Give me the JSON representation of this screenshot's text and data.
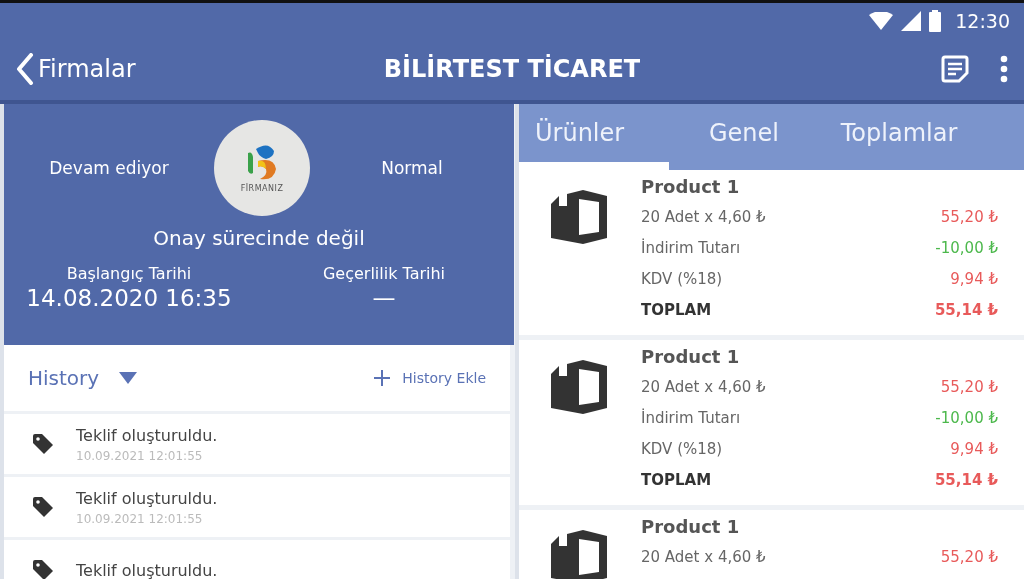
{
  "status_bar": {
    "time": "12:30"
  },
  "app_bar": {
    "back_label": "Firmalar",
    "title": "BİLİRTEST TİCARET"
  },
  "summary": {
    "status_left": "Devam ediyor",
    "logo_text": "FİRMANIZ",
    "status_right": "Normal",
    "approval": "Onay sürecinde değil",
    "start_label": "Başlangıç Tarihi",
    "start_value": "14.08.2020 16:35",
    "valid_label": "Geçerlilik Tarihi",
    "valid_value": "—"
  },
  "history": {
    "title": "History",
    "add_label": "History Ekle",
    "expanded": true,
    "items": [
      {
        "text": "Teklif oluşturuldu.",
        "date": "10.09.2021 12:01:55"
      },
      {
        "text": "Teklif oluşturuldu.",
        "date": "10.09.2021 12:01:55"
      },
      {
        "text": "Teklif oluşturuldu."
      }
    ]
  },
  "tabs": [
    {
      "label": "Ürünler",
      "selected": true
    },
    {
      "label": "Genel",
      "selected": false
    },
    {
      "label": "Toplamlar",
      "selected": false
    }
  ],
  "products": [
    {
      "name": "Product 1",
      "lines": [
        {
          "kind": "normal",
          "label": "20 Adet x 4,60 ₺",
          "amount": "55,20 ₺",
          "color": "#e85a5a"
        },
        {
          "kind": "normal",
          "label": "İndirim Tutarı",
          "amount": "-10,00 ₺",
          "color": "#4cb84c"
        },
        {
          "kind": "normal",
          "label": "KDV (%18)",
          "amount": "9,94 ₺",
          "color": "#e85a5a"
        },
        {
          "kind": "total",
          "label": "TOPLAM",
          "amount": "55,14 ₺",
          "color": "#e85a5a"
        }
      ]
    },
    {
      "name": "Product 1",
      "lines": [
        {
          "kind": "normal",
          "label": "20 Adet x 4,60 ₺",
          "amount": "55,20 ₺",
          "color": "#e85a5a"
        },
        {
          "kind": "normal",
          "label": "İndirim Tutarı",
          "amount": "-10,00 ₺",
          "color": "#4cb84c"
        },
        {
          "kind": "normal",
          "label": "KDV (%18)",
          "amount": "9,94 ₺",
          "color": "#e85a5a"
        },
        {
          "kind": "total",
          "label": "TOPLAM",
          "amount": "55,14 ₺",
          "color": "#e85a5a"
        }
      ]
    },
    {
      "name": "Product 1",
      "lines": [
        {
          "kind": "normal",
          "label": "20 Adet x 4,60 ₺",
          "amount": "55,20 ₺",
          "color": "#e85a5a"
        }
      ]
    }
  ]
}
